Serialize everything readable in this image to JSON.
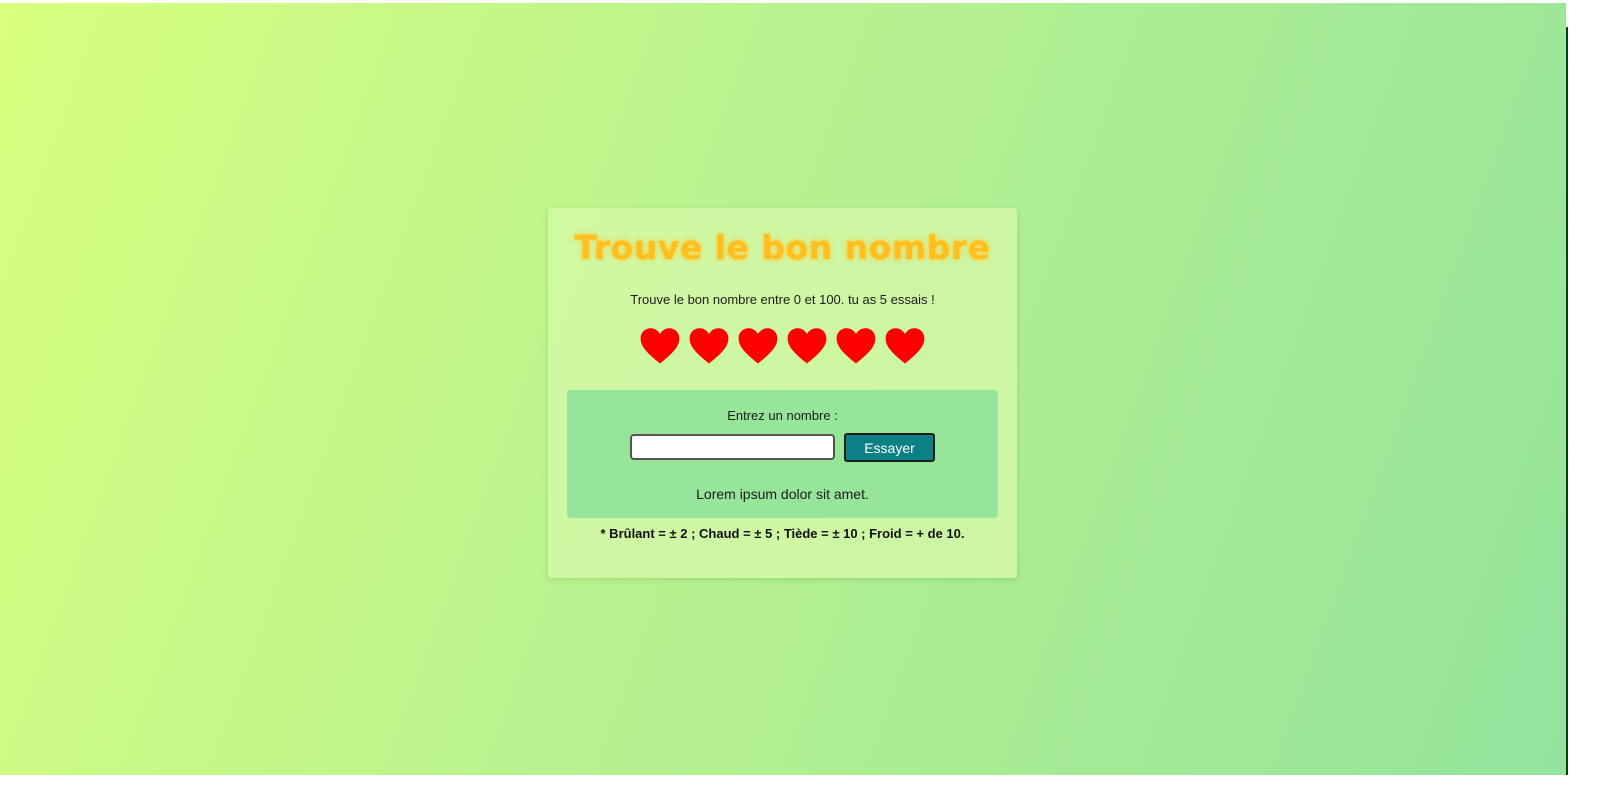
{
  "game": {
    "title": "Trouve le bon nombre",
    "intro": "Trouve le bon nombre entre 0 et 100. tu as 5 essais !",
    "lives": 6,
    "heart_color": "#ff0000",
    "input_label": "Entrez un nombre :",
    "input_value": "",
    "button_label": "Essayer",
    "feedback": "Lorem ipsum dolor sit amet.",
    "legend": "* Brûlant = ± 2 ; Chaud = ± 5 ; Tiède = ± 10 ; Froid = + de 10."
  },
  "colors": {
    "title": "#ffbf1f",
    "button": "#0b8085",
    "panel": "#97e49b"
  }
}
